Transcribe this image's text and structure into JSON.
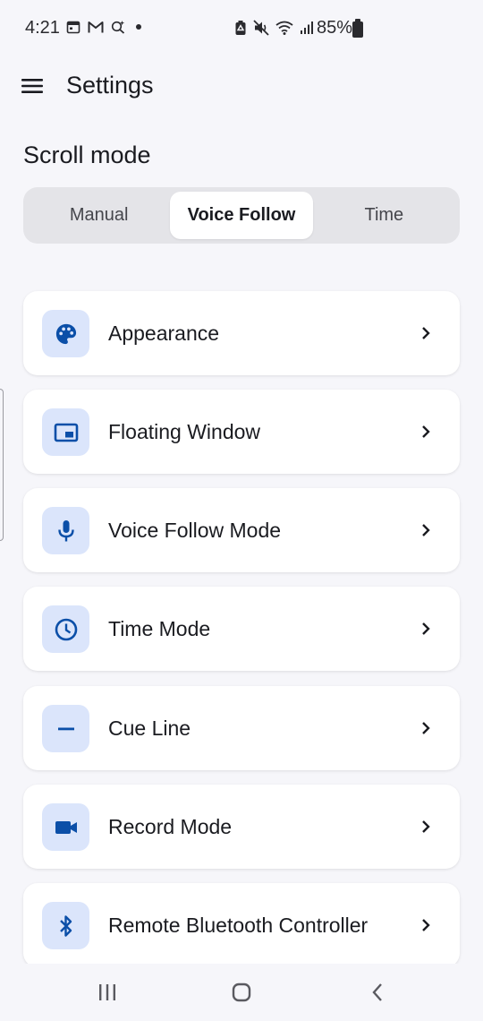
{
  "status_bar": {
    "time": "4:21",
    "battery": "85%",
    "left_icons": [
      "calendar-icon",
      "gmail-icon",
      "assistant-icon"
    ],
    "right_icons": [
      "battery-saver-icon",
      "mute-icon",
      "wifi-icon",
      "signal-icon"
    ]
  },
  "app_bar": {
    "title": "Settings",
    "menu_icon": "menu-icon"
  },
  "scroll_mode": {
    "title": "Scroll mode",
    "options": [
      "Manual",
      "Voice Follow",
      "Time"
    ],
    "selected": "Voice Follow"
  },
  "settings_items": [
    {
      "label": "Appearance",
      "icon": "palette-icon"
    },
    {
      "label": "Floating Window",
      "icon": "picture-in-picture-icon"
    },
    {
      "label": "Voice Follow Mode",
      "icon": "microphone-icon"
    },
    {
      "label": "Time Mode",
      "icon": "clock-icon"
    },
    {
      "label": "Cue Line",
      "icon": "minus-icon"
    },
    {
      "label": "Record Mode",
      "icon": "videocam-icon"
    },
    {
      "label": "Remote Bluetooth Controller",
      "icon": "bluetooth-icon"
    }
  ],
  "nav_bar": {
    "buttons": [
      "recents-icon",
      "home-icon",
      "back-icon"
    ]
  },
  "colors": {
    "background": "#f6f6fa",
    "card": "#ffffff",
    "icon_tile": "#dbe5fb",
    "icon_blue": "#0b4fa8",
    "segment_track": "#e4e4e8"
  }
}
